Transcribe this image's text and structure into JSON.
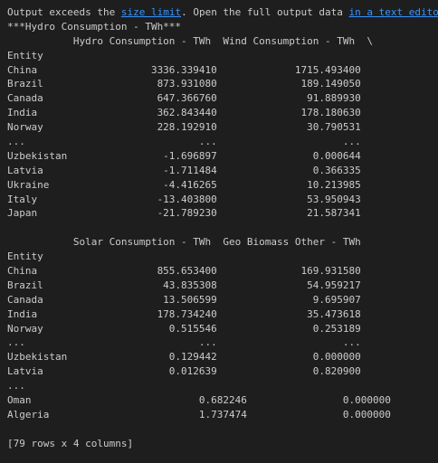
{
  "banner": {
    "prefix": "Output exceeds the ",
    "size_limit_link": "size limit",
    "middle": ". Open the full output data ",
    "text_editor_link": "in a text editor"
  },
  "title": "***Hydro Consumption - TWh***",
  "table1": {
    "header": "           Hydro Consumption - TWh  Wind Consumption - TWh  \\",
    "index_label": "Entity",
    "rows": [
      "China                   3336.339410             1715.493400",
      "Brazil                   873.931080              189.149050",
      "Canada                   647.366760               91.889930",
      "India                    362.843440              178.180630",
      "Norway                   228.192910               30.790531",
      "...                             ...                     ...",
      "Uzbekistan                -1.696897                0.000644",
      "Latvia                    -1.711484                0.366335",
      "Ukraine                   -4.416265               10.213985",
      "Italy                    -13.403800               53.950943",
      "Japan                    -21.789230               21.587341"
    ]
  },
  "table2": {
    "header": "           Solar Consumption - TWh  Geo Biomass Other - TWh",
    "index_label": "Entity",
    "rows": [
      "China                    855.653400              169.931580",
      "Brazil                    43.835308               54.959217",
      "Canada                    13.506599                9.695907",
      "India                    178.734240               35.473618",
      "Norway                     0.515546                0.253189",
      "...                             ...                     ...",
      "Uzbekistan                 0.129442                0.000000",
      "Latvia                     0.012639                0.820900",
      "...",
      "Oman                            0.682246                0.000000",
      "Algeria                         1.737474                0.000000"
    ]
  },
  "footer": "[79 rows x 4 columns]"
}
